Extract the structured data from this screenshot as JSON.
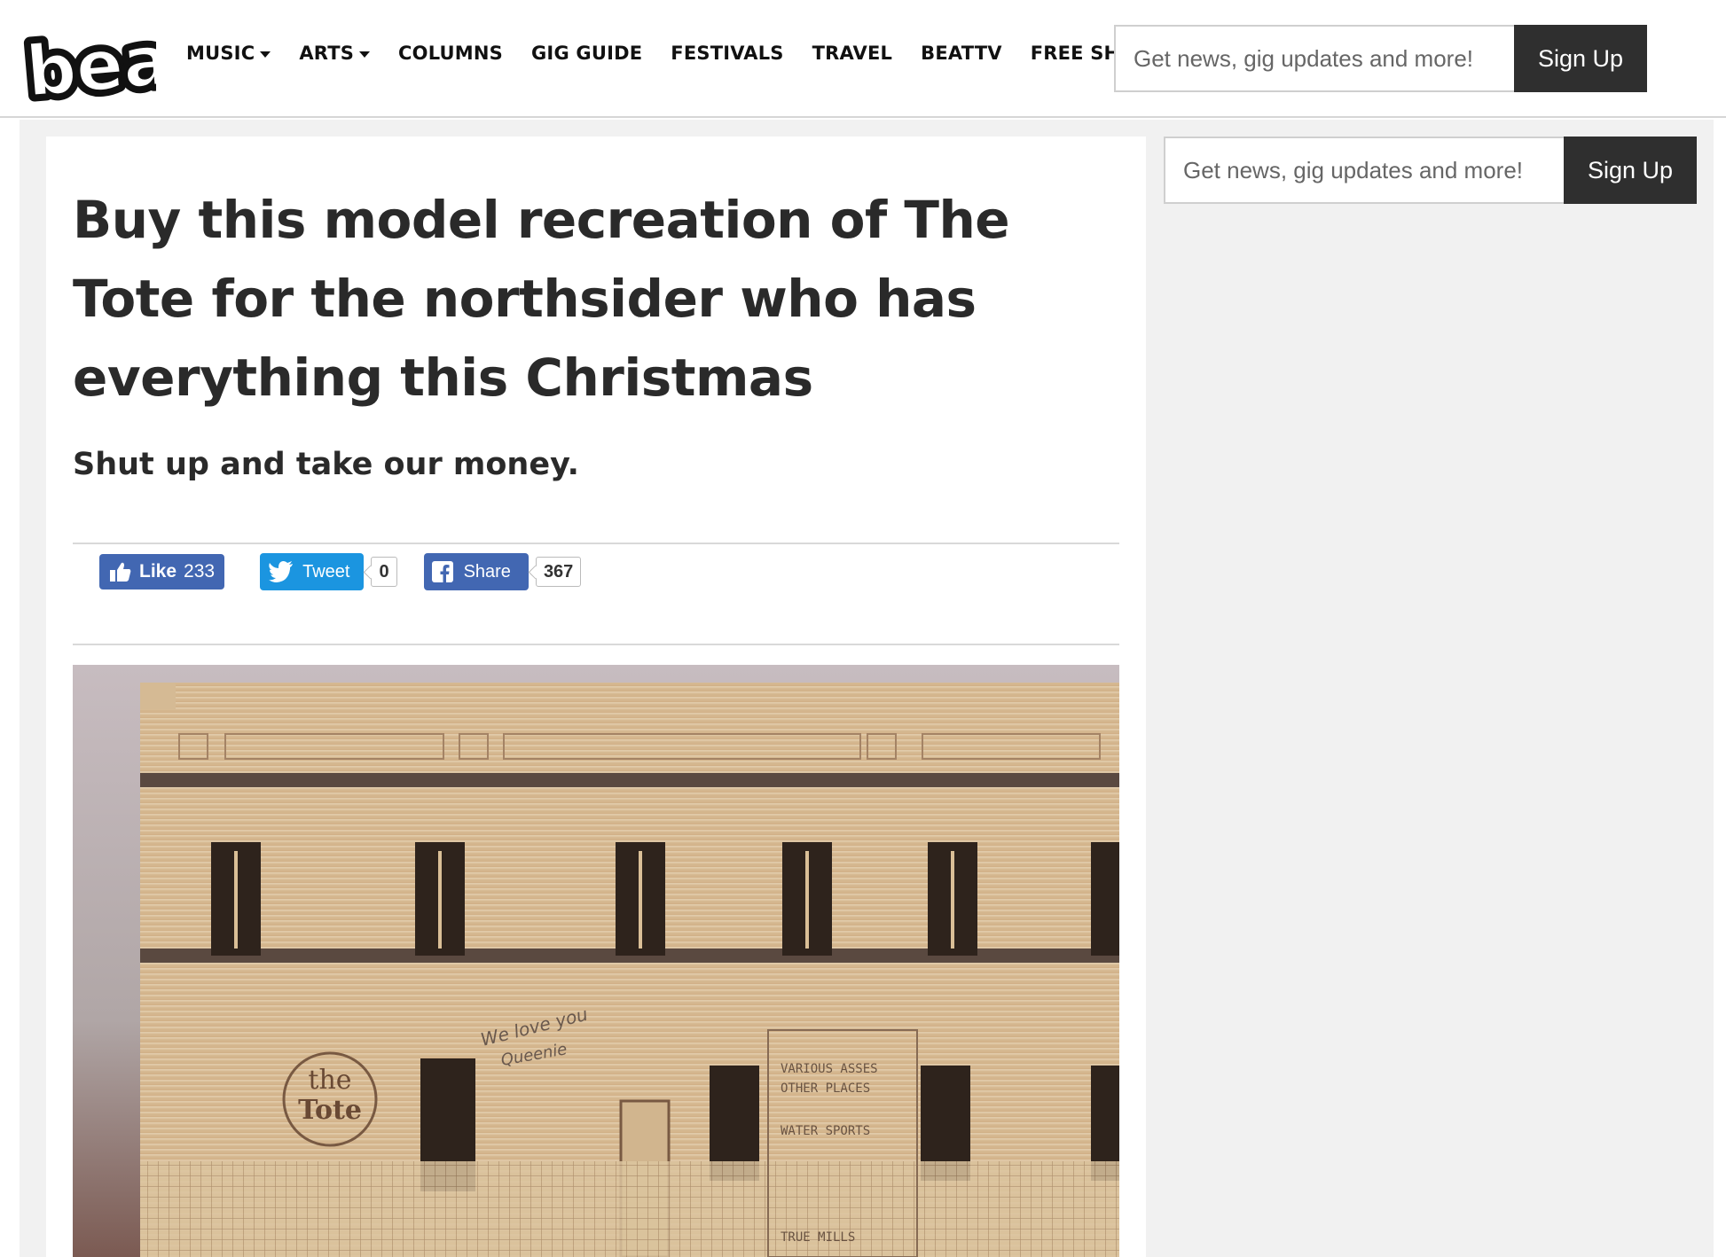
{
  "header": {
    "logo_text": "beat",
    "nav": [
      {
        "label": "MUSIC",
        "dropdown": true
      },
      {
        "label": "ARTS",
        "dropdown": true
      },
      {
        "label": "COLUMNS",
        "dropdown": false
      },
      {
        "label": "GIG GUIDE",
        "dropdown": false
      },
      {
        "label": "FESTIVALS",
        "dropdown": false
      },
      {
        "label": "TRAVEL",
        "dropdown": false
      },
      {
        "label": "BEATTV",
        "dropdown": false
      },
      {
        "label": "FREE SHIT",
        "dropdown": false
      }
    ],
    "signup": {
      "placeholder": "Get news, gig updates and more!",
      "button": "Sign Up"
    }
  },
  "sidebar": {
    "signup": {
      "placeholder": "Get news, gig updates and more!",
      "button": "Sign Up"
    }
  },
  "article": {
    "headline": "Buy this model recreation of The Tote for the northsider who has everything this Christmas",
    "subhead": "Shut up and take our money.",
    "social": {
      "like_label": "Like",
      "like_count": "233",
      "tweet_label": "Tweet",
      "tweet_count": "0",
      "share_label": "Share",
      "share_count": "367"
    },
    "image": {
      "sign_top": "the",
      "sign_bottom": "Tote",
      "graffiti_1": "We love you",
      "graffiti_2": "Queenie",
      "poster_lines": [
        "VARIOUS ASSES",
        "OTHER PLACES",
        "WATER SPORTS",
        "TRUE MILLS"
      ]
    }
  },
  "colors": {
    "facebook": "#4267b2",
    "twitter": "#1b95e0",
    "button_dark": "#2f2f2f",
    "page_gray": "#f1f1f1"
  }
}
